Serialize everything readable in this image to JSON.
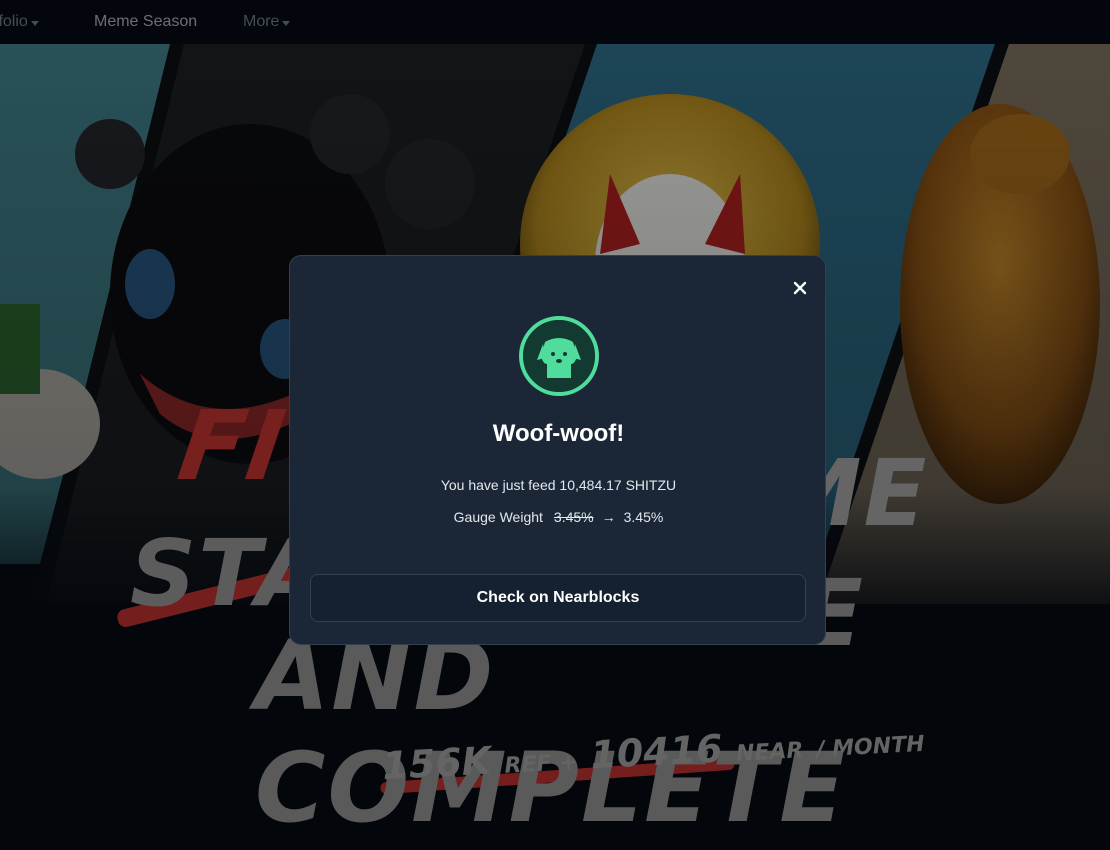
{
  "nav": {
    "items": [
      {
        "label": "tfolio",
        "has_caret": true
      },
      {
        "label": "Meme Season",
        "has_caret": false
      },
      {
        "label": "More",
        "has_caret": true
      }
    ]
  },
  "hero": {
    "line1": "FI",
    "line1b": "ME",
    "line2": "STA",
    "line2b": "E",
    "line3": "AND COMPLETE",
    "sub_a": "156K",
    "sub_b": "REF +",
    "sub_c": "10416",
    "sub_d": "NEAR",
    "sub_e": "/ MONTH"
  },
  "modal": {
    "close_icon": "close-icon",
    "avatar_icon": "dog-avatar-icon",
    "title": "Woof-woof!",
    "message": "You have just feed 10,484.17 SHITZU",
    "gauge_label": "Gauge Weight",
    "gauge_old": "3.45%",
    "gauge_arrow": "→",
    "gauge_new": "3.45%",
    "button_label": "Check on Nearblocks"
  },
  "colors": {
    "accent": "#4fdc9d",
    "modal_bg": "#1b2737",
    "page_bg": "#050a12",
    "hero_red": "#b3302d"
  }
}
